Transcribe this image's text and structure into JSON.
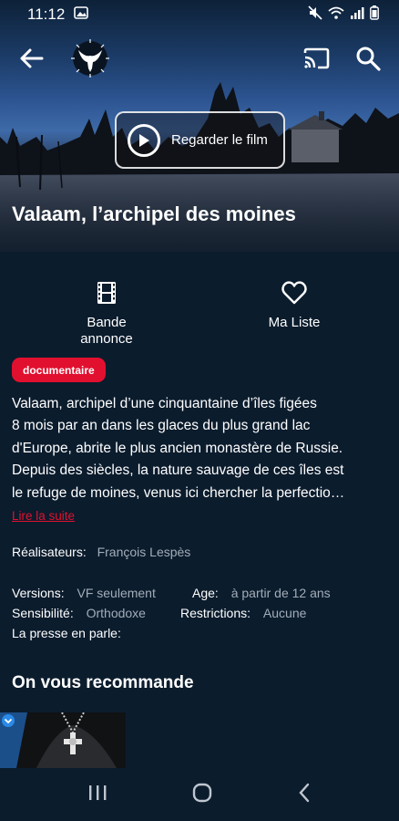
{
  "status_bar": {
    "time": "11:12",
    "icons": [
      "image-icon",
      "mute-icon",
      "wifi-icon",
      "signal-icon",
      "battery-icon"
    ]
  },
  "top_bar": {
    "icons": [
      "back-arrow-icon",
      "dove-logo-icon",
      "cast-icon",
      "search-icon"
    ]
  },
  "hero": {
    "play_label": "Regarder le film",
    "title": "Valaam, l’archipel des moines"
  },
  "actions": {
    "trailer_label": "Bande annonce",
    "mylist_label": "Ma Liste"
  },
  "genre_tag": "documentaire",
  "synopsis": {
    "lines": [
      "Valaam, archipel d’une cinquantaine d’îles figées",
      "8 mois par an dans les glaces du plus grand lac",
      "d'Europe, abrite le plus ancien monastère de Russie.",
      "Depuis des siècles, la nature sauvage de ces îles est",
      "le refuge de moines, venus ici chercher la perfectio…"
    ],
    "read_more": "Lire la suite"
  },
  "details": {
    "directors_label": "Réalisateurs:",
    "directors_value": "François Lespès",
    "versions_label": "Versions:",
    "versions_value": "VF seulement",
    "age_label": "Age:",
    "age_value": "à partir de 12 ans",
    "sensibility_label": "Sensibilité:",
    "sensibility_value": "Orthodoxe",
    "restrictions_label": "Restrictions:",
    "restrictions_value": "Aucune",
    "press_label": "La presse en parle:"
  },
  "recommendations": {
    "title": "On vous recommande"
  },
  "colors": {
    "background": "#0b1c2d",
    "accent": "#e2102f",
    "muted_text": "#a3adb8"
  }
}
